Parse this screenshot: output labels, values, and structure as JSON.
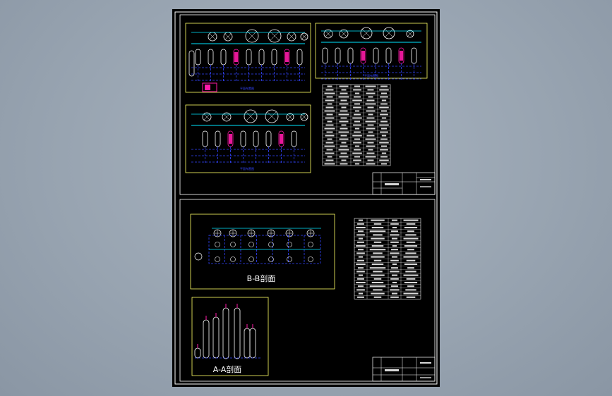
{
  "viewer": {
    "background": "#9aa6b3",
    "sheet_color": "#000000",
    "frame_color": "#ffffff"
  },
  "colors": {
    "frame_yellow": "#ffff66",
    "pipe_blue": "#3344ff",
    "equip_white": "#ffffff",
    "accent_magenta": "#ff1aa8",
    "accent_cyan": "#00e6ff"
  },
  "drawing": {
    "section_bb_label": "B-B剖面",
    "section_aa_label": "A-A剖面"
  }
}
